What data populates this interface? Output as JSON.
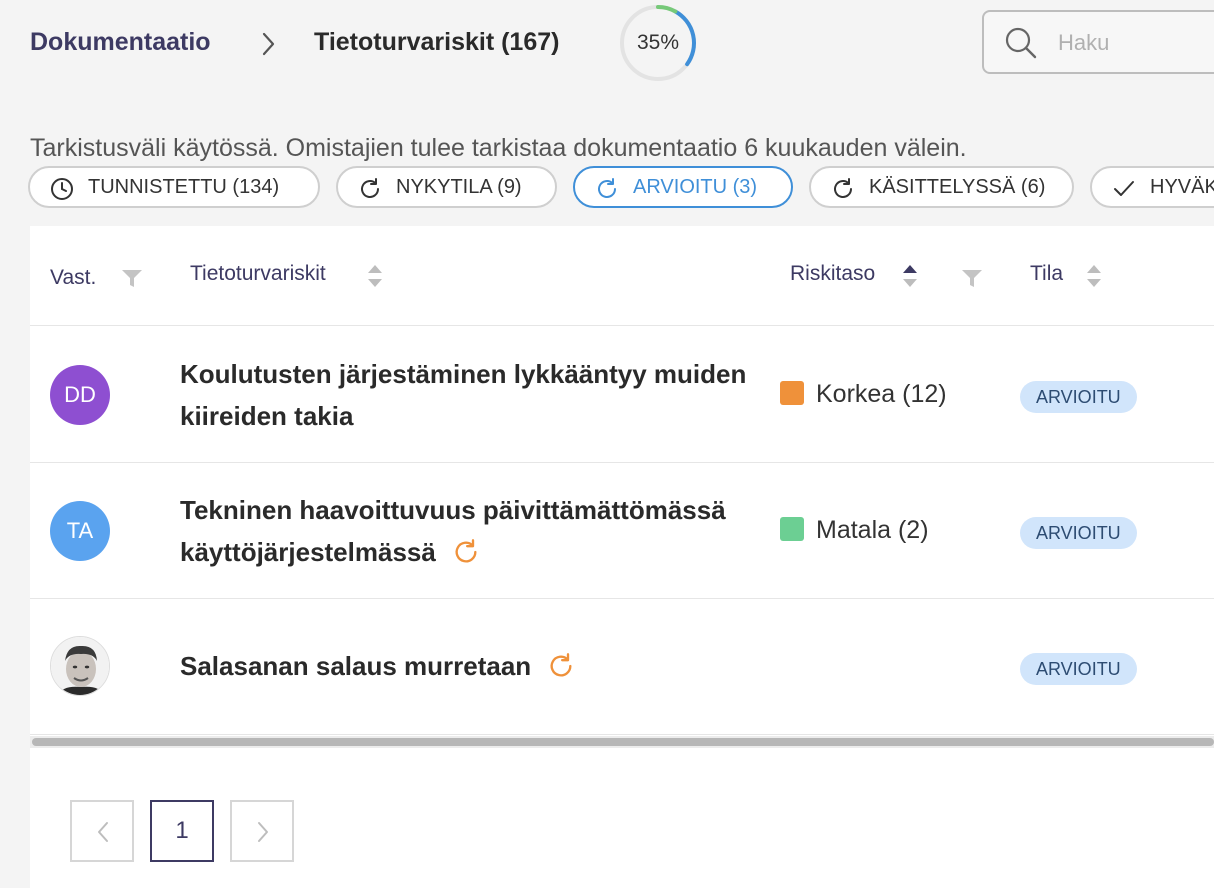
{
  "header": {
    "breadcrumb_root": "Dokumentaatio",
    "breadcrumb_current": "Tietoturvariskit (167)",
    "progress_label": "35%",
    "progress_value": 0.35,
    "search_placeholder": "Haku"
  },
  "notice": "Tarkistusväli käytössä. Omistajien tulee tarkistaa dokumentaatio 6 kuukauden välein.",
  "filters": [
    {
      "label": "TUNNISTETTU (134)",
      "icon": "clock-icon",
      "active": false
    },
    {
      "label": "NYKYTILA (9)",
      "icon": "refresh-icon",
      "active": false
    },
    {
      "label": "ARVIOITU (3)",
      "icon": "refresh-icon",
      "active": true
    },
    {
      "label": "KÄSITTELYSSÄ (6)",
      "icon": "refresh-icon",
      "active": false
    },
    {
      "label": "HYVÄK",
      "icon": "check-icon",
      "active": false
    }
  ],
  "table": {
    "columns": {
      "owner": "Vast.",
      "risk": "Tietoturvariskit",
      "level": "Riskitaso",
      "status": "Tila"
    },
    "rows": [
      {
        "owner_initials": "DD",
        "owner_color": "#8e4fd1",
        "title": "Koulutusten järjestäminen lykkääntyy muiden kiireiden takia",
        "level": "Korkea (12)",
        "level_color": "#ef913a",
        "status": "ARVIOITU"
      },
      {
        "owner_initials": "TA",
        "owner_color": "#5aa3ef",
        "title": "Tekninen haavoittuvuus päivittämättömässä käyttöjärjestelmässä",
        "level": "Matala (2)",
        "level_color": "#6ccf93",
        "status": "ARVIOITU"
      },
      {
        "owner_initials": "",
        "owner_color": "",
        "title": "Salasanan salaus murretaan",
        "level": "",
        "level_color": "",
        "status": "ARVIOITU"
      }
    ]
  },
  "pagination": {
    "current_page": "1"
  },
  "colors": {
    "accent": "#3f8fd8",
    "brand": "#3d3a63",
    "badge_bg": "#d1e5fb",
    "progress_arc": "#3f8fd8",
    "progress_cap": "#76c979"
  }
}
